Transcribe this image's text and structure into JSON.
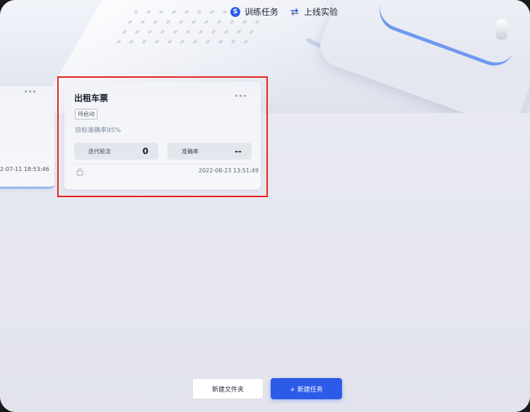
{
  "nav": {
    "training_tasks": "训练任务",
    "online_experiment": "上线实验",
    "training_icon_letter": "S"
  },
  "cards": {
    "left": {
      "timestamp": "2-07-11 18:53:46"
    },
    "main": {
      "title": "出租车票",
      "status_badge": "待启动",
      "target_accuracy": "目标准确率95%",
      "iterations_label": "迭代轮次",
      "iterations_value": "0",
      "accuracy_label": "准确率",
      "accuracy_value": "--",
      "timestamp": "2022-08-23 13:51:49"
    }
  },
  "actions": {
    "new_folder": "新建文件夹",
    "new_task": "+ 新建任务"
  },
  "colors": {
    "accent": "#2d5be9",
    "highlight": "#e2231a"
  },
  "icons": {
    "more": "more-dots-icon",
    "lock": "unlock-icon",
    "swap": "swap-arrows-icon"
  }
}
